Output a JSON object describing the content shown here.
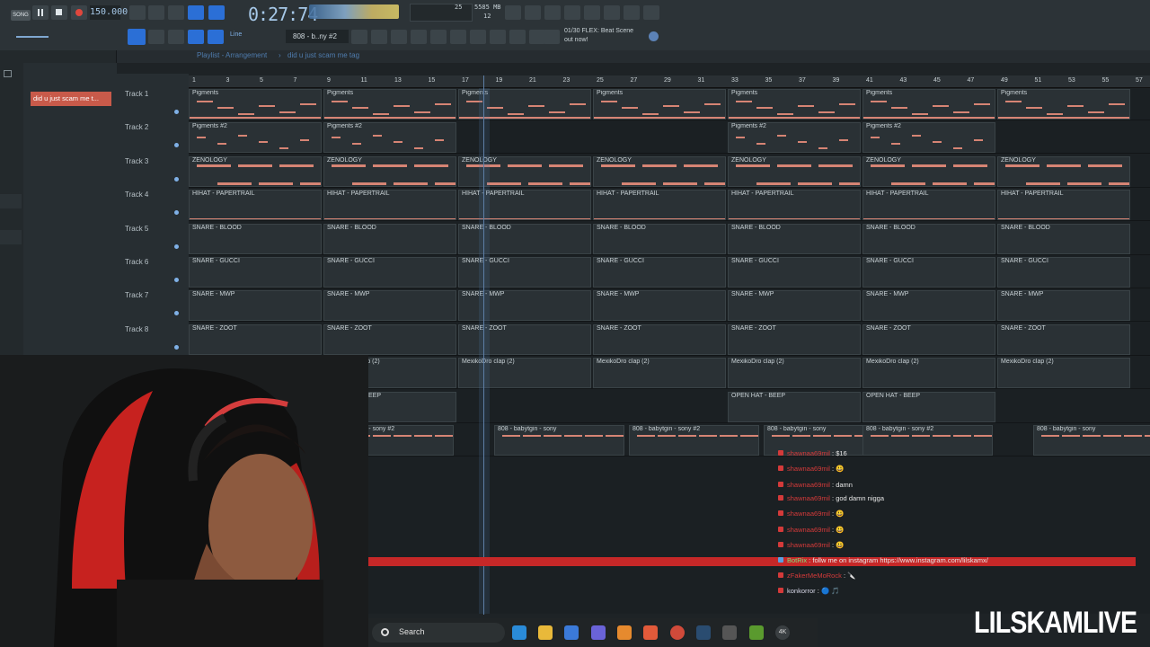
{
  "topbar": {
    "song_label": "SONG",
    "tempo": "150.000",
    "time": "0:27:74",
    "memory": "5585 MB",
    "cpu": "12",
    "voices": "25",
    "pattern": "808 - b..ny #2",
    "snap": "Line",
    "hint_line1": "01/30  FLEX: Beat Scene",
    "hint_line2": "out now!"
  },
  "playlist": {
    "breadcrumb": "Playlist - Arrangement",
    "separator": "›",
    "arrangement": "did u just scam me tag",
    "selected_pattern": "did u just scam me t..."
  },
  "ruler": [
    "1",
    "3",
    "5",
    "7",
    "9",
    "11",
    "13",
    "15",
    "17",
    "19",
    "21",
    "23",
    "25",
    "27",
    "29",
    "31",
    "33",
    "35",
    "37",
    "39",
    "41",
    "43",
    "45",
    "47",
    "49",
    "51",
    "53",
    "55",
    "57"
  ],
  "tracks": [
    {
      "label": "Track 1",
      "clip": "Pigments"
    },
    {
      "label": "Track 2",
      "clip": "Pigments #2"
    },
    {
      "label": "Track 3",
      "clip": "ZENOLOGY"
    },
    {
      "label": "Track 4",
      "clip": "HIHAT - PAPERTRAIL"
    },
    {
      "label": "Track 5",
      "clip": "SNARE - BLOOD"
    },
    {
      "label": "Track 6",
      "clip": "SNARE - GUCCI"
    },
    {
      "label": "Track 7",
      "clip": "SNARE - MWP"
    },
    {
      "label": "Track 8",
      "clip": "SNARE - ZOOT"
    },
    {
      "label": "Track 9",
      "clip": "MexikoDro clap (2)"
    },
    {
      "label": "",
      "clip": "OPEN HAT - BEEP"
    },
    {
      "label": "",
      "clip": "808 - babytgin - sony #2",
      "clip_alt": "808 - babytgin - sony"
    }
  ],
  "chat": [
    {
      "user": "shawnaa69mil",
      "msg": "$16"
    },
    {
      "user": "shawnaa69mil",
      "msg": "😃"
    },
    {
      "user": "shawnaa69mil",
      "msg": "damn"
    },
    {
      "user": "shawnaa69mil",
      "msg": "god damn nigga"
    },
    {
      "user": "shawnaa69mil",
      "msg": "😃"
    },
    {
      "user": "shawnaa69mil",
      "msg": "😃"
    },
    {
      "user": "shawnaa69mil",
      "msg": "😃"
    },
    {
      "user": "BotRix",
      "msg": "follw me on instagram https://www.instagram.com/lilskamx/"
    },
    {
      "user": "zFakerMeMoRock",
      "msg": "🔪"
    },
    {
      "user": "konkorror",
      "msg": "🔵 🎵"
    }
  ],
  "taskbar": {
    "search": "Search",
    "badge": "4K"
  },
  "brand": "LILSKAMLIVE",
  "colors": {
    "accent": "#2b6fd6",
    "note": "#d68474",
    "chat_red": "#c62828",
    "brand": "#ffffff"
  }
}
